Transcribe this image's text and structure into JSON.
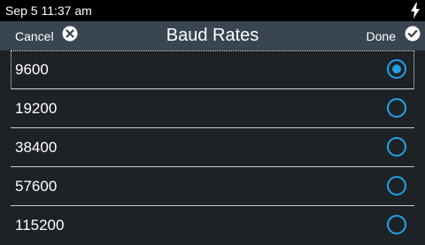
{
  "status_bar": {
    "time": "Sep 5 11:37 am",
    "power_icon": "lightning-bolt-icon"
  },
  "nav": {
    "cancel_label": "Cancel",
    "title": "Baud Rates",
    "done_label": "Done",
    "cancel_icon": "close-circle-icon",
    "done_icon": "check-circle-icon"
  },
  "options": [
    {
      "label": "9600",
      "selected": true
    },
    {
      "label": "19200",
      "selected": false
    },
    {
      "label": "38400",
      "selected": false
    },
    {
      "label": "57600",
      "selected": false
    },
    {
      "label": "115200",
      "selected": false
    }
  ],
  "colors": {
    "accent": "#1fa3e8",
    "nav_bg": "#3a4552",
    "list_bg": "#1e2226"
  }
}
